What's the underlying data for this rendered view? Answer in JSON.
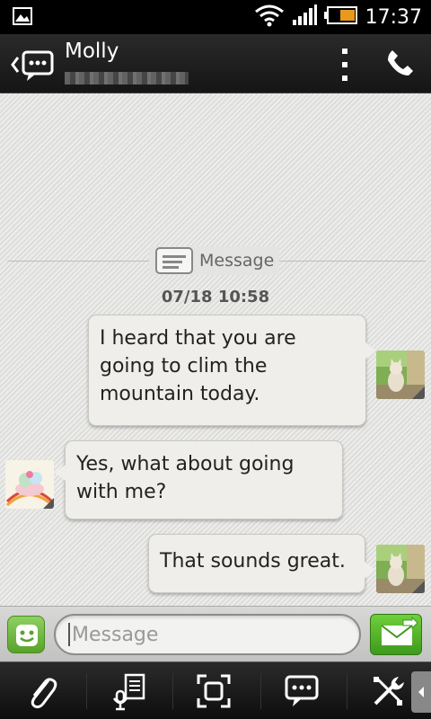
{
  "status_bar": {
    "time": "17:37"
  },
  "header": {
    "contact_name": "Molly"
  },
  "conversation": {
    "divider_label": "Message",
    "date": "07/18 10:58",
    "messages": [
      {
        "direction": "outgoing",
        "text": "I heard that you are going to clim the mountain today."
      },
      {
        "direction": "incoming",
        "text": "Yes, what about going with me?"
      },
      {
        "direction": "outgoing",
        "text": "That sounds great."
      }
    ]
  },
  "composer": {
    "placeholder": "Message"
  },
  "colors": {
    "accent_green": "#58a32a",
    "bubble": "#efeeea",
    "header_bg": "#1e1e1e"
  }
}
